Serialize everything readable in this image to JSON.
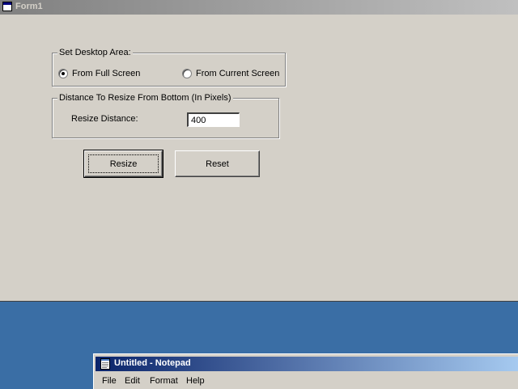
{
  "form1": {
    "title": "Form1",
    "group_desktop": {
      "legend": "Set Desktop Area:",
      "options": [
        {
          "label": "From Full Screen",
          "selected": true
        },
        {
          "label": "From Current Screen",
          "selected": false
        }
      ]
    },
    "group_distance": {
      "legend": "Distance To Resize From Bottom (In Pixels)",
      "resize_label": "Resize Distance:",
      "resize_value": "400"
    },
    "buttons": {
      "resize": "Resize",
      "reset": "Reset"
    }
  },
  "notepad": {
    "title": "Untitled - Notepad",
    "menu": [
      "File",
      "Edit",
      "Format",
      "Help"
    ]
  },
  "colors": {
    "desktop": "#3a6ea5",
    "face": "#d4d0c8",
    "active_title_start": "#0a246a",
    "active_title_end": "#a6caf0",
    "inactive_title_start": "#808080",
    "inactive_title_end": "#c0c0c0"
  },
  "icons": {
    "form1": "window-icon",
    "notepad": "notepad-icon"
  }
}
